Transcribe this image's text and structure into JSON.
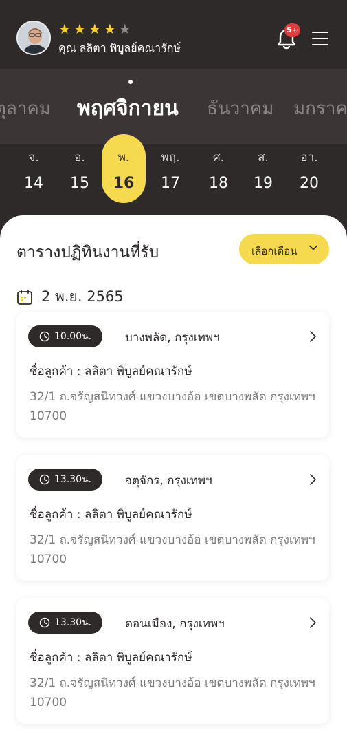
{
  "header": {
    "rating": 4,
    "rating_max": 5,
    "user_name": "คุณ ลลิตา พิบูลย์คณารักษ์",
    "notification_badge": "5+"
  },
  "months": {
    "items": [
      "ตุลาคม",
      "พฤศจิกายน",
      "ธันวาคม",
      "มกราคม"
    ],
    "selected": "พฤศจิกายน"
  },
  "days": [
    {
      "name": "จ.",
      "date": "14"
    },
    {
      "name": "อ.",
      "date": "15"
    },
    {
      "name": "พ.",
      "date": "16"
    },
    {
      "name": "พฤ.",
      "date": "17"
    },
    {
      "name": "ศ.",
      "date": "18"
    },
    {
      "name": "ส.",
      "date": "19"
    },
    {
      "name": "อา.",
      "date": "20"
    }
  ],
  "selected_day": "16",
  "schedule": {
    "title": "ตารางปฏิทินงานที่รับ",
    "month_button_label": "เลือกเดือน",
    "date_label": "2 พ.ย. 2565",
    "cards": [
      {
        "time": "10.00น.",
        "location": "บางพลัด, กรุงเทพฯ",
        "customer": "ชื่อลูกค้า : ลลิตา พิบูลย์คณารักษ์",
        "address": "32/1 ถ.จรัญสนิทวงศ์ แขวงบางอ้อ เขตบางพลัด กรุงเทพฯ 10700"
      },
      {
        "time": "13.30น.",
        "location": "จตุจักร, กรุงเทพฯ",
        "customer": "ชื่อลูกค้า : ลลิตา พิบูลย์คณารักษ์",
        "address": "32/1 ถ.จรัญสนิทวงศ์ แขวงบางอ้อ เขตบางพลัด กรุงเทพฯ 10700"
      },
      {
        "time": "13.30น.",
        "location": "ดอนเมือง, กรุงเทพฯ",
        "customer": "ชื่อลูกค้า : ลลิตา พิบูลย์คณารักษ์",
        "address": "32/1 ถ.จรัญสนิทวงศ์ แขวงบางอ้อ เขตบางพลัด กรุงเทพฯ 10700"
      }
    ]
  },
  "colors": {
    "dark": "#2f2a2a",
    "accent_yellow": "#f5d94e",
    "star": "#f6cf2f",
    "badge_red": "#e23b3b"
  }
}
